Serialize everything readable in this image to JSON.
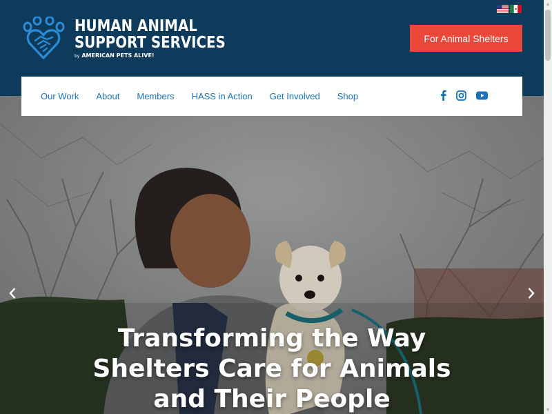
{
  "header": {
    "logo": {
      "line1": "HUMAN ANIMAL",
      "line2": "SUPPORT SERVICES",
      "by": "by",
      "brand": "AMERICAN PETS ALIVE!",
      "icon": "paw-heart-handshake-icon"
    },
    "flags": [
      {
        "name": "us-flag-icon"
      },
      {
        "name": "mexico-flag-icon"
      }
    ],
    "cta_label": "For Animal Shelters"
  },
  "nav": {
    "items": [
      {
        "label": "Our Work"
      },
      {
        "label": "About"
      },
      {
        "label": "Members"
      },
      {
        "label": "HASS in Action"
      },
      {
        "label": "Get Involved"
      },
      {
        "label": "Shop"
      }
    ],
    "social": [
      {
        "icon": "facebook-icon"
      },
      {
        "icon": "instagram-icon"
      },
      {
        "icon": "youtube-icon"
      }
    ]
  },
  "hero": {
    "title_line1": "Transforming the Way",
    "title_line2": "Shelters Care for Animals",
    "title_line3": "and Their People",
    "prev_arrow": "‹",
    "next_arrow": "›"
  },
  "colors": {
    "brand_navy": "#0e3a5c",
    "accent_red": "#e8473a",
    "nav_link": "#1a72b8",
    "logo_blue": "#2a8bd6"
  }
}
